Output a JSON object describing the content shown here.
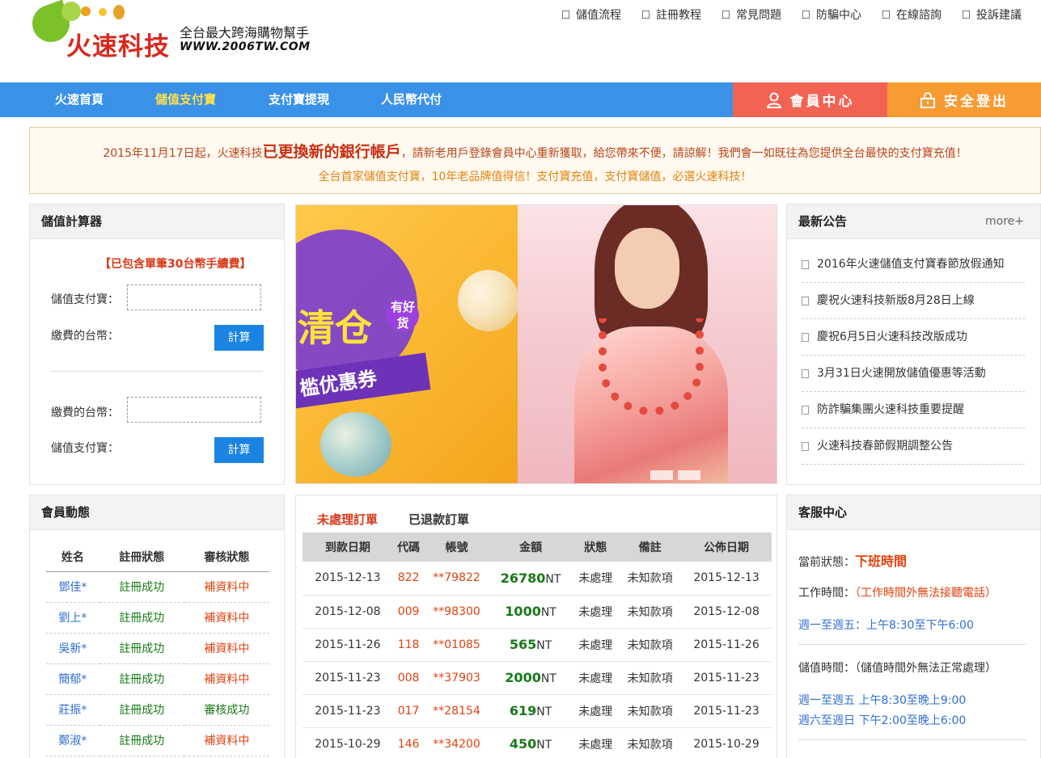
{
  "logo": {
    "brand": "火速科技",
    "slogan": "全台最大跨海購物幫手",
    "site": "WWW.2006TW.COM"
  },
  "toplinks": [
    "儲值流程",
    "註冊教程",
    "常見問題",
    "防騙中心",
    "在線諮詢",
    "投訴建議"
  ],
  "nav": {
    "items": [
      "火速首頁",
      "儲值支付寶",
      "支付寶提現",
      "人民幣代付"
    ],
    "active_index": 1,
    "member": "會員中心",
    "logout": "安全登出"
  },
  "notice": {
    "line1_pre": "2015年11月17日起，火速科技",
    "line1_big": "已更換新的銀行帳戶",
    "line1_post": "，請新老用戶登錄會員中心重新獲取，給您帶來不便，請諒解！我們會一如既往為您提供全台最快的支付寶充值！",
    "line2": "全台首家儲值支付寶，10年老品牌值得信！支付寶充值，支付寶儲值，必選火速科技！"
  },
  "calc": {
    "title": "儲值計算器",
    "fee_note": "【已包含單筆30台幣手續費】",
    "label_alipay": "儲值支付寶：",
    "label_twd": "繳費的台幣：",
    "button": "計算"
  },
  "banner": {
    "text_main": "清仓",
    "text_tag": "有好货",
    "text_ribbon": "槛优惠券"
  },
  "announce": {
    "title": "最新公告",
    "more": "more+",
    "items": [
      "2016年火速儲值支付寶春節放假通知",
      "慶祝火速科技新版8月28日上線",
      "慶祝6月5日火速科技改版成功",
      "3月31日火速開放儲值優惠等活動",
      "防詐騙集團火速科技重要提醒",
      "火速科技春節假期調整公告"
    ]
  },
  "members": {
    "title": "會員動態",
    "headers": [
      "姓名",
      "註冊狀態",
      "審核狀態"
    ],
    "rows": [
      [
        "鄧佳*",
        "註冊成功",
        "補資料中"
      ],
      [
        "劉上*",
        "註冊成功",
        "補資料中"
      ],
      [
        "吳新*",
        "註冊成功",
        "補資料中"
      ],
      [
        "簡郁*",
        "註冊成功",
        "補資料中"
      ],
      [
        "莊振*",
        "註冊成功",
        "審核成功"
      ],
      [
        "鄭淑*",
        "註冊成功",
        "補資料中"
      ]
    ]
  },
  "orders": {
    "tab_pending": "未處理訂單",
    "tab_refunded": "已退款訂單",
    "headers": [
      "到款日期",
      "代碼",
      "帳號",
      "金額",
      "狀態",
      "備註",
      "公佈日期"
    ],
    "currency": "NT",
    "rows": [
      [
        "2015-12-13",
        "822",
        "**79822",
        "26780",
        "未處理",
        "未知款項",
        "2015-12-13"
      ],
      [
        "2015-12-08",
        "009",
        "**98300",
        "1000",
        "未處理",
        "未知款項",
        "2015-12-08"
      ],
      [
        "2015-11-26",
        "118",
        "**01085",
        "565",
        "未處理",
        "未知款項",
        "2015-11-26"
      ],
      [
        "2015-11-23",
        "008",
        "**37903",
        "2000",
        "未處理",
        "未知款項",
        "2015-11-23"
      ],
      [
        "2015-11-23",
        "017",
        "**28154",
        "619",
        "未處理",
        "未知款項",
        "2015-11-23"
      ],
      [
        "2015-10-29",
        "146",
        "**34200",
        "450",
        "未處理",
        "未知款項",
        "2015-10-29"
      ]
    ]
  },
  "service": {
    "title": "客服中心",
    "status_label": "當前狀態：",
    "status_value": "下班時間",
    "work_label": "工作時間：",
    "work_note": "（工作時間外無法接聽電話）",
    "work_hours": "週一至週五：上午8:30至下午6:00",
    "topup_label": "儲值時間：（儲值時間外無法正常處理）",
    "topup_hours_1": "週一至週五 上午8:30至晚上9:00",
    "topup_hours_2": "週六至週日 下午2:00至晚上6:00"
  }
}
